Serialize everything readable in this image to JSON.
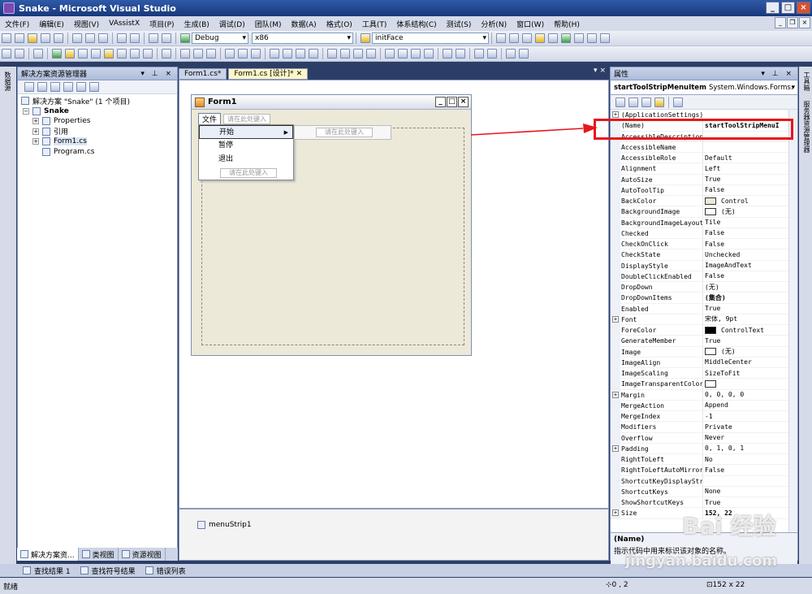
{
  "window": {
    "title": "Snake - Microsoft Visual Studio"
  },
  "menubar": {
    "items": [
      "文件(F)",
      "编辑(E)",
      "视图(V)",
      "VAssistX",
      "项目(P)",
      "生成(B)",
      "调试(D)",
      "团队(M)",
      "数据(A)",
      "格式(O)",
      "工具(T)",
      "体系结构(C)",
      "测试(S)",
      "分析(N)",
      "窗口(W)",
      "帮助(H)"
    ]
  },
  "toolbar": {
    "config": "Debug",
    "platform": "x86",
    "find": "initFace"
  },
  "solution_explorer": {
    "title": "解决方案资源管理器",
    "root": "解决方案 \"Snake\" (1 个项目)",
    "project": "Snake",
    "items": [
      "Properties",
      "引用",
      "Form1.cs",
      "Program.cs"
    ],
    "tabs": [
      "解决方案资...",
      "类视图",
      "资源视图"
    ]
  },
  "left_strip": {
    "label": "数据源"
  },
  "doc_tabs": [
    "Form1.cs*",
    "Form1.cs [设计]*"
  ],
  "designer": {
    "form_title": "Form1",
    "menu_file": "文件",
    "type_here": "请在此处键入",
    "dropdown_items": [
      "开始",
      "暂停",
      "退出"
    ],
    "tray_component": "menuStrip1"
  },
  "properties": {
    "title": "属性",
    "object_name": "startToolStripMenuItem",
    "object_type": "System.Windows.Forms.",
    "rows": [
      {
        "name": "(ApplicationSettings)",
        "value": "",
        "expand": "+",
        "category": true
      },
      {
        "name": "(Name)",
        "value": "startToolStripMenuI",
        "highlight": true
      },
      {
        "name": "AccessibleDescription",
        "value": ""
      },
      {
        "name": "AccessibleName",
        "value": ""
      },
      {
        "name": "AccessibleRole",
        "value": "Default"
      },
      {
        "name": "Alignment",
        "value": "Left"
      },
      {
        "name": "AutoSize",
        "value": "True"
      },
      {
        "name": "AutoToolTip",
        "value": "False"
      },
      {
        "name": "BackColor",
        "value": "Control",
        "swatch": "#ece9d8"
      },
      {
        "name": "BackgroundImage",
        "value": "(无)",
        "swatch": "#ffffff"
      },
      {
        "name": "BackgroundImageLayout",
        "value": "Tile"
      },
      {
        "name": "Checked",
        "value": "False"
      },
      {
        "name": "CheckOnClick",
        "value": "False"
      },
      {
        "name": "CheckState",
        "value": "Unchecked"
      },
      {
        "name": "DisplayStyle",
        "value": "ImageAndText"
      },
      {
        "name": "DoubleClickEnabled",
        "value": "False"
      },
      {
        "name": "DropDown",
        "value": "(无)"
      },
      {
        "name": "DropDownItems",
        "value": "(集合)",
        "bold": true
      },
      {
        "name": "Enabled",
        "value": "True"
      },
      {
        "name": "Font",
        "value": "宋体, 9pt",
        "expand": "+"
      },
      {
        "name": "ForeColor",
        "value": "ControlText",
        "swatch": "#000000"
      },
      {
        "name": "GenerateMember",
        "value": "True"
      },
      {
        "name": "Image",
        "value": "(无)",
        "swatch": "#ffffff"
      },
      {
        "name": "ImageAlign",
        "value": "MiddleCenter"
      },
      {
        "name": "ImageScaling",
        "value": "SizeToFit"
      },
      {
        "name": "ImageTransparentColor",
        "value": "",
        "swatch": "#ffffff"
      },
      {
        "name": "Margin",
        "value": "0, 0, 0, 0",
        "expand": "+"
      },
      {
        "name": "MergeAction",
        "value": "Append"
      },
      {
        "name": "MergeIndex",
        "value": "-1"
      },
      {
        "name": "Modifiers",
        "value": "Private"
      },
      {
        "name": "Overflow",
        "value": "Never"
      },
      {
        "name": "Padding",
        "value": "0, 1, 0, 1",
        "expand": "+"
      },
      {
        "name": "RightToLeft",
        "value": "No"
      },
      {
        "name": "RightToLeftAutoMirror",
        "value": "False"
      },
      {
        "name": "ShortcutKeyDisplayStr",
        "value": ""
      },
      {
        "name": "ShortcutKeys",
        "value": "None"
      },
      {
        "name": "ShowShortcutKeys",
        "value": "True"
      },
      {
        "name": "Size",
        "value": "152, 22",
        "expand": "+",
        "bold": true
      }
    ],
    "desc_title": "(Name)",
    "desc_text": "指示代码中用来标识该对象的名称。"
  },
  "right_strip": {
    "items": [
      "工具箱",
      "服务器资源管理器"
    ]
  },
  "bottom_tabs": [
    "查找结果 1",
    "查找符号结果",
    "错误列表"
  ],
  "status": {
    "left": "就绪",
    "position": "0 , 2",
    "size": "152 x 22"
  },
  "watermark": {
    "logo": "Bai 经验",
    "url": "jingyan.baidu.com"
  },
  "colors": {
    "accent": "#e8161b",
    "titlebar": "#17377a",
    "chrome": "#d5dbe9"
  }
}
